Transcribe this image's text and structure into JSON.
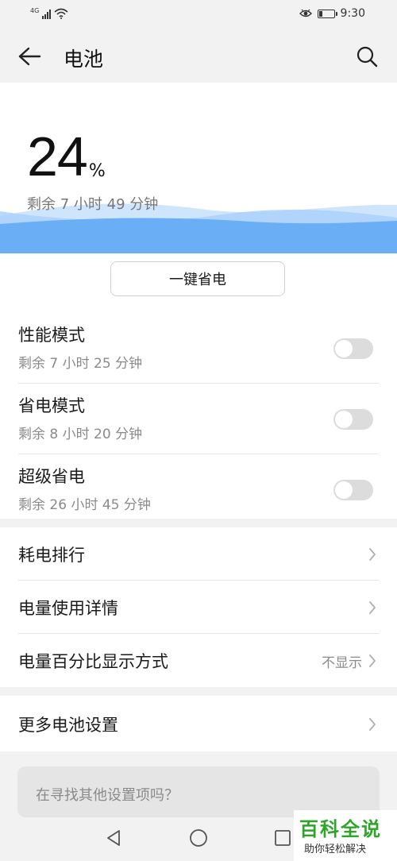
{
  "status_bar": {
    "network_tag": "4G",
    "time": "9:30",
    "battery_level": 0.24,
    "icons": [
      "signal-icon",
      "wifi-icon",
      "eye-comfort-icon",
      "battery-icon"
    ]
  },
  "header": {
    "title": "电池",
    "icons": [
      "back-arrow-icon",
      "search-icon"
    ]
  },
  "battery": {
    "percent": "24",
    "percent_sign": "%",
    "remaining": "剩余 7 小时 49 分钟"
  },
  "one_key_save": "一键省电",
  "modes": [
    {
      "name": "性能模式",
      "remaining": "剩余 7 小时 25 分钟",
      "enabled": false
    },
    {
      "name": "省电模式",
      "remaining": "剩余 8 小时 20 分钟",
      "enabled": false
    },
    {
      "name": "超级省电",
      "remaining": "剩余 26 小时 45 分钟",
      "enabled": false
    }
  ],
  "menu": [
    {
      "label": "耗电排行",
      "value": ""
    },
    {
      "label": "电量使用详情",
      "value": ""
    },
    {
      "label": "电量百分比显示方式",
      "value": "不显示"
    }
  ],
  "more_settings": {
    "label": "更多电池设置"
  },
  "search_prompt": "在寻找其他设置项吗？",
  "nav_bar": {
    "icons": [
      "back-triangle-icon",
      "home-circle-icon",
      "recents-square-icon"
    ]
  },
  "watermark": {
    "title": "百科全说",
    "subtitle": "助你轻松解决"
  },
  "colors": {
    "wave": "#6aaef5",
    "toggle_off": "#dcdcdc",
    "watermark_green": "#2ea52a"
  }
}
